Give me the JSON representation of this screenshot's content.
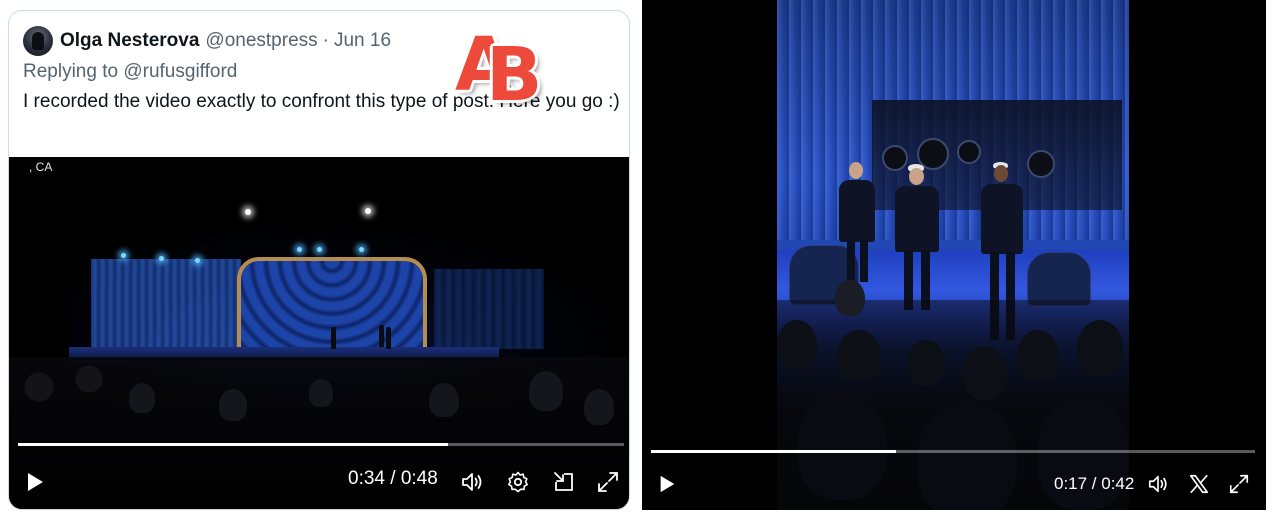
{
  "panel_a": {
    "label": "A",
    "tweet": {
      "author_name": "Olga Nesterova",
      "author_handle": "@onestpress",
      "separator": "·",
      "date": "Jun 16",
      "replying_prefix": "Replying to",
      "replying_handle": "@rufusgifford",
      "text": "I recorded the video exactly to confront this type of post. Here you go :)"
    },
    "video": {
      "location_text": ", CA",
      "time_display": "0:34 / 0:48",
      "progress": 0.71,
      "icons": [
        "play-icon",
        "volume-icon",
        "settings-icon",
        "pop-out-icon",
        "fullscreen-icon"
      ]
    }
  },
  "panel_b": {
    "label": "B",
    "video": {
      "time_display": "0:17 / 0:42",
      "progress": 0.405,
      "icons": [
        "play-icon",
        "volume-icon",
        "x-logo-icon",
        "fullscreen-icon"
      ]
    }
  },
  "colors": {
    "label_red": "#ee4a3c",
    "text_primary": "#0f1419",
    "text_secondary": "#536471",
    "card_border": "#cfd9de"
  }
}
